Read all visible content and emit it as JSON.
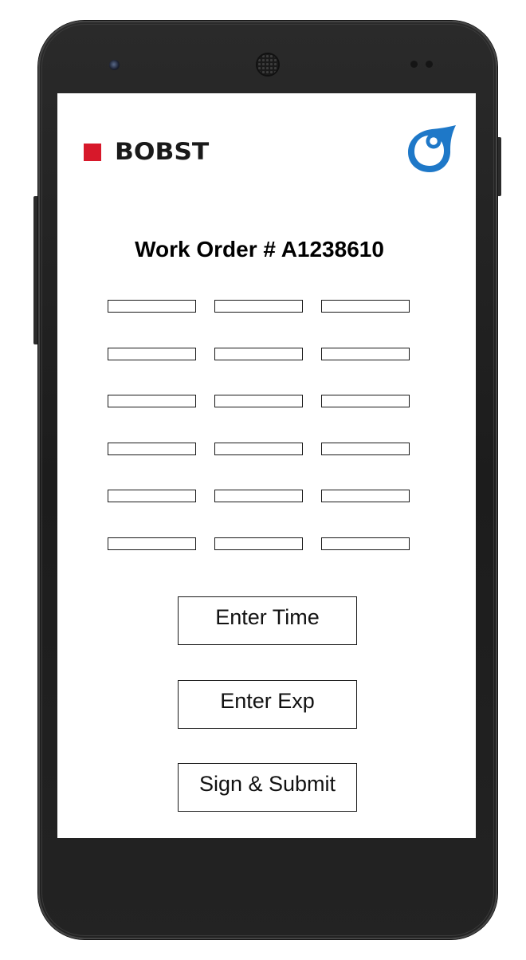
{
  "header": {
    "brand_name": "BOBST",
    "brand_color": "#d7182a",
    "secondary_logo_icon": "water-drop-logo-icon",
    "secondary_logo_color": "#1e78c8"
  },
  "work_order": {
    "title": "Work Order # A1238610"
  },
  "form_grid": {
    "rows": [
      {
        "cells": [
          "",
          "",
          ""
        ]
      },
      {
        "cells": [
          "",
          "",
          ""
        ]
      },
      {
        "cells": [
          "",
          "",
          ""
        ]
      },
      {
        "cells": [
          "",
          "",
          ""
        ]
      },
      {
        "cells": [
          "",
          "",
          ""
        ]
      },
      {
        "cells": [
          "",
          "",
          ""
        ]
      }
    ]
  },
  "actions": {
    "enter_time_label": "Enter Time",
    "enter_exp_label": "Enter Exp",
    "sign_submit_label": "Sign & Submit"
  }
}
